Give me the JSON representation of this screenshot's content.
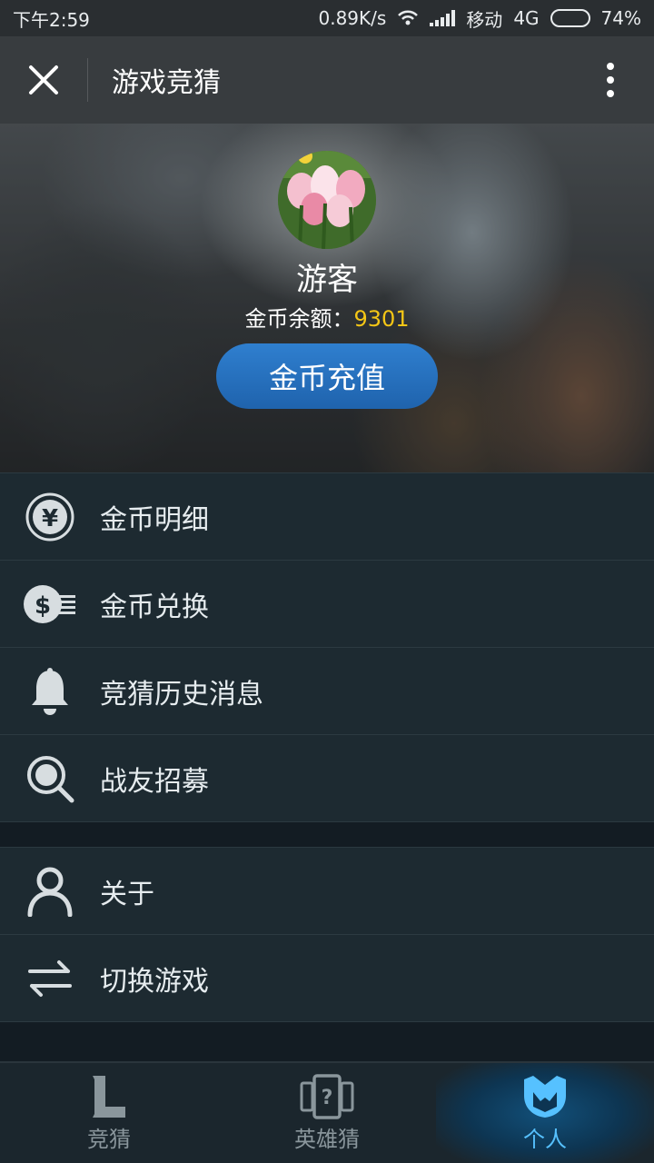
{
  "status_bar": {
    "time": "下午2:59",
    "speed": "0.89K/s",
    "carrier": "移动",
    "network": "4G",
    "battery": "74%",
    "battery_level": 0.74
  },
  "app_bar": {
    "title": "游戏竞猜",
    "close_icon": "close-icon",
    "more_icon": "more-vertical-icon"
  },
  "profile": {
    "username": "游客",
    "balance_label": "金币余额：",
    "balance_value": "9301",
    "recharge_label": "金币充值",
    "accent": "#f4c616",
    "button_color": "#2a74c2"
  },
  "menu_primary": [
    {
      "label": "金币明细",
      "icon": "yen-coin-icon"
    },
    {
      "label": "金币兑换",
      "icon": "dollar-exchange-icon"
    },
    {
      "label": " 竞猜历史消息",
      "icon": "bell-icon"
    },
    {
      "label": "战友招募",
      "icon": "search-icon"
    }
  ],
  "menu_secondary": [
    {
      "label": "关于",
      "icon": "user-icon"
    },
    {
      "label": "切换游戏",
      "icon": "swap-icon"
    }
  ],
  "bottom_nav": [
    {
      "label": "竞猜",
      "icon": "league-l-icon",
      "active": false
    },
    {
      "label": "英雄猜",
      "icon": "hero-cards-icon",
      "active": false
    },
    {
      "label": "个人",
      "icon": "helmet-icon",
      "active": true
    }
  ],
  "colors": {
    "active_nav": "#56c1ff",
    "inactive_nav": "#8a969c"
  }
}
